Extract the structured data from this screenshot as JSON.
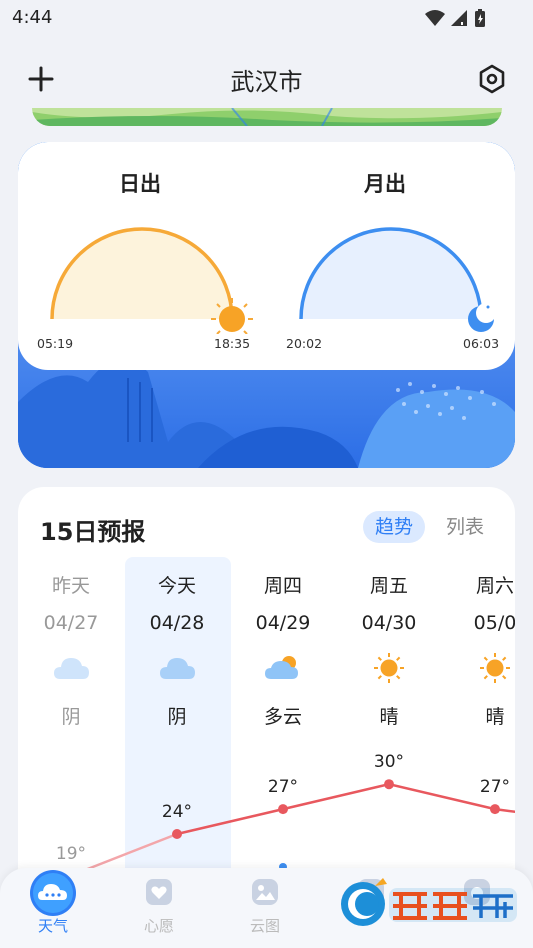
{
  "status_bar": {
    "time": "4:44"
  },
  "header": {
    "city": "武汉市"
  },
  "sun_moon": {
    "sunrise": {
      "title": "日出",
      "start": "05:19",
      "end": "18:35"
    },
    "moonrise": {
      "title": "月出",
      "start": "20:02",
      "end": "06:03"
    }
  },
  "forecast": {
    "title": "15日预报",
    "tabs": {
      "trend": "趋势",
      "list": "列表"
    },
    "days": [
      {
        "name": "昨天",
        "date": "04/27",
        "condition": "阴",
        "icon": "cloud-icon",
        "high": "19°"
      },
      {
        "name": "今天",
        "date": "04/28",
        "condition": "阴",
        "icon": "cloud-icon",
        "high": "24°"
      },
      {
        "name": "周四",
        "date": "04/29",
        "condition": "多云",
        "icon": "partly-cloudy-icon",
        "high": "27°"
      },
      {
        "name": "周五",
        "date": "04/30",
        "condition": "晴",
        "icon": "sun-icon",
        "high": "30°"
      },
      {
        "name": "周六",
        "date": "05/0",
        "condition": "晴",
        "icon": "sun-icon",
        "high": "27°"
      }
    ]
  },
  "chart_data": {
    "type": "line",
    "categories": [
      "04/27",
      "04/28",
      "04/29",
      "04/30",
      "05/0"
    ],
    "series": [
      {
        "values": [
          19,
          24,
          27,
          30,
          27
        ]
      }
    ],
    "colors": {
      "line": "#e8585e",
      "past_line": "#f3a6aa"
    }
  },
  "bottom_nav": {
    "items": [
      {
        "label": "天气",
        "icon": "cloud-icon",
        "active": true
      },
      {
        "label": "心愿",
        "icon": "heart-card-icon",
        "active": false
      },
      {
        "label": "云图",
        "icon": "picture-icon",
        "active": false
      }
    ]
  },
  "colors": {
    "accent": "#2f7ff5",
    "sun_arc": "#f6a938",
    "moon_arc": "#3d8ef0",
    "temp_line": "#e8585e"
  }
}
